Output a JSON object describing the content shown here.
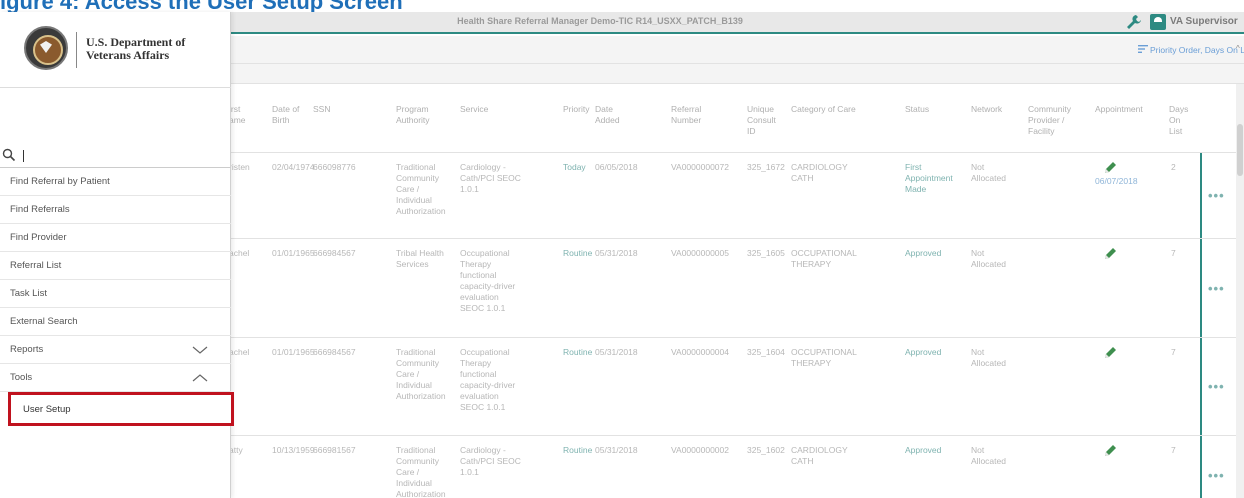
{
  "caption": "igure 4: Access the User Setup Screen",
  "header": {
    "title": "Health Share Referral Manager Demo-TIC R14_USXX_PATCH_B139",
    "user": "VA Supervisor"
  },
  "toolbar": {
    "sort_label": "Priority Order, Days On List"
  },
  "logo": {
    "line1": "U.S. Department of",
    "line2": "Veterans Affairs"
  },
  "search": {
    "placeholder": "",
    "value": ""
  },
  "menu": {
    "items": [
      "Find Referral by Patient",
      "Find Referrals",
      "Find Provider",
      "Referral List",
      "Task List",
      "External Search",
      "Reports",
      "Tools"
    ],
    "user_setup": "User Setup"
  },
  "table": {
    "headers": {
      "first_name": [
        "irst",
        "ame"
      ],
      "dob": [
        "Date of",
        "Birth"
      ],
      "ssn": [
        "SSN"
      ],
      "program": [
        "Program",
        "Authority"
      ],
      "service": [
        "Service"
      ],
      "priority": [
        "Priority"
      ],
      "date_added": [
        "Date",
        "Added"
      ],
      "referral": [
        "Referral",
        "Number"
      ],
      "unique": [
        "Unique",
        "Consult",
        "ID"
      ],
      "category": [
        "Category of Care"
      ],
      "status": [
        "Status"
      ],
      "network": [
        "Network"
      ],
      "community": [
        "Community",
        "Provider /",
        "Facility"
      ],
      "appointment": [
        "Appointment"
      ],
      "days": [
        "Days",
        "On",
        "List"
      ]
    },
    "rows": [
      {
        "first": "risten",
        "dob": "02/04/1974",
        "ssn": "666098776",
        "program": [
          "Traditional",
          "Community",
          "Care /",
          "Individual",
          "Authorization"
        ],
        "service": [
          "Cardiology -",
          "Cath/PCI SEOC",
          "1.0.1"
        ],
        "priority": "Today",
        "date_added": "06/05/2018",
        "referral": "VA0000000072",
        "unique": "325_1672",
        "category": [
          "CARDIOLOGY",
          "CATH"
        ],
        "status": [
          "First",
          "Appointment",
          "Made"
        ],
        "network": [
          "Not",
          "Allocated"
        ],
        "appointment_date": "06/07/2018",
        "days": "2"
      },
      {
        "first": "achel",
        "dob": "01/01/1965",
        "ssn": "666984567",
        "program": [
          "Tribal Health",
          "Services"
        ],
        "service": [
          "Occupational",
          "Therapy",
          "functional",
          "capacity-driver",
          "evaluation",
          "SEOC 1.0.1"
        ],
        "priority": "Routine",
        "date_added": "05/31/2018",
        "referral": "VA0000000005",
        "unique": "325_1605",
        "category": [
          "OCCUPATIONAL",
          "THERAPY"
        ],
        "status": [
          "Approved"
        ],
        "network": [
          "Not",
          "Allocated"
        ],
        "appointment_date": "",
        "days": "7"
      },
      {
        "first": "achel",
        "dob": "01/01/1965",
        "ssn": "666984567",
        "program": [
          "Traditional",
          "Community",
          "Care /",
          "Individual",
          "Authorization"
        ],
        "service": [
          "Occupational",
          "Therapy",
          "functional",
          "capacity-driver",
          "evaluation",
          "SEOC 1.0.1"
        ],
        "priority": "Routine",
        "date_added": "05/31/2018",
        "referral": "VA0000000004",
        "unique": "325_1604",
        "category": [
          "OCCUPATIONAL",
          "THERAPY"
        ],
        "status": [
          "Approved"
        ],
        "network": [
          "Not",
          "Allocated"
        ],
        "appointment_date": "",
        "days": "7"
      },
      {
        "first": "atty",
        "dob": "10/13/1959",
        "ssn": "666981567",
        "program": [
          "Traditional",
          "Community",
          "Care /",
          "Individual",
          "Authorization"
        ],
        "service": [
          "Cardiology -",
          "Cath/PCI SEOC",
          "1.0.1"
        ],
        "priority": "Routine",
        "date_added": "05/31/2018",
        "referral": "VA0000000002",
        "unique": "325_1602",
        "category": [
          "CARDIOLOGY",
          "CATH"
        ],
        "status": [
          "Approved"
        ],
        "network": [
          "Not",
          "Allocated"
        ],
        "appointment_date": "",
        "days": "7"
      }
    ],
    "more_label": "•••"
  },
  "colors": {
    "accent": "#2d8a82",
    "highlight": "#c0121e",
    "link": "#1f6fb8"
  }
}
